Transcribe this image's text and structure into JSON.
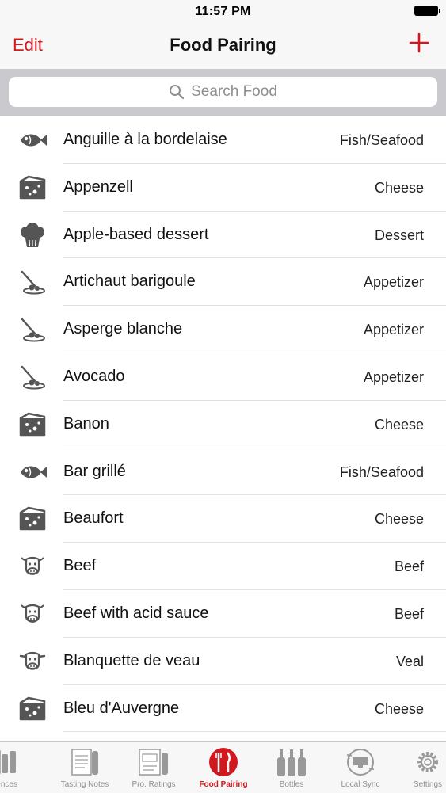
{
  "status_bar": {
    "time": "11:57 PM"
  },
  "nav": {
    "edit_label": "Edit",
    "title": "Food Pairing",
    "add_icon": "plus-icon"
  },
  "search": {
    "placeholder": "Search Food",
    "icon": "search-icon"
  },
  "accent_color": "#d0181f",
  "foods": [
    {
      "name": "Anguille à la bordelaise",
      "category": "Fish/Seafood",
      "icon": "fish-icon"
    },
    {
      "name": "Appenzell",
      "category": "Cheese",
      "icon": "cheese-icon"
    },
    {
      "name": "Apple-based dessert",
      "category": "Dessert",
      "icon": "cupcake-icon"
    },
    {
      "name": "Artichaut barigoule",
      "category": "Appetizer",
      "icon": "appetizer-icon"
    },
    {
      "name": "Asperge blanche",
      "category": "Appetizer",
      "icon": "appetizer-icon"
    },
    {
      "name": "Avocado",
      "category": "Appetizer",
      "icon": "appetizer-icon"
    },
    {
      "name": "Banon",
      "category": "Cheese",
      "icon": "cheese-icon"
    },
    {
      "name": "Bar grillé",
      "category": "Fish/Seafood",
      "icon": "fish-icon"
    },
    {
      "name": "Beaufort",
      "category": "Cheese",
      "icon": "cheese-icon"
    },
    {
      "name": "Beef",
      "category": "Beef",
      "icon": "cow-icon"
    },
    {
      "name": "Beef with acid sauce",
      "category": "Beef",
      "icon": "cow-icon"
    },
    {
      "name": "Blanquette de veau",
      "category": "Veal",
      "icon": "calf-icon"
    },
    {
      "name": "Bleu d'Auvergne",
      "category": "Cheese",
      "icon": "cheese-icon"
    }
  ],
  "tabs": [
    {
      "label": "eferences",
      "icon": "preferences-icon",
      "active": false
    },
    {
      "label": "Tasting Notes",
      "icon": "tasting-notes-icon",
      "active": false
    },
    {
      "label": "Pro. Ratings",
      "icon": "pro-ratings-icon",
      "active": false
    },
    {
      "label": "Food Pairing",
      "icon": "food-pairing-icon",
      "active": true
    },
    {
      "label": "Bottles",
      "icon": "bottles-icon",
      "active": false
    },
    {
      "label": "Local Sync",
      "icon": "local-sync-icon",
      "active": false
    },
    {
      "label": "Settings",
      "icon": "gear-icon",
      "active": false
    }
  ]
}
